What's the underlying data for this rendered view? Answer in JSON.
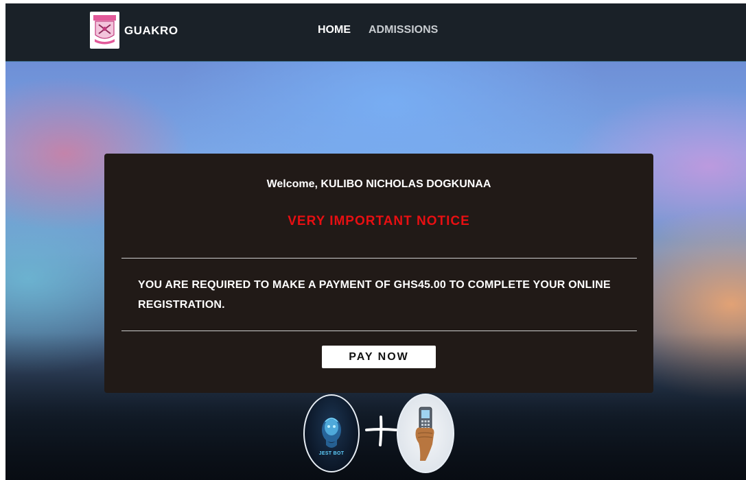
{
  "header": {
    "brand": "GUAKRO",
    "nav": [
      {
        "label": "HOME",
        "active": true
      },
      {
        "label": "ADMISSIONS",
        "active": false
      }
    ]
  },
  "notice": {
    "welcome": "Welcome, KULIBO NICHOLAS DOGKUNAA",
    "title": "VERY IMPORTANT NOTICE",
    "title_color": "#e80f12",
    "message": "YOU ARE REQUIRED TO MAKE A PAYMENT OF GHS45.00 TO COMPLETE YOUR ONLINE REGISTRATION.",
    "button_label": "PAY NOW"
  },
  "badges": {
    "bot_caption": "JEST BOT",
    "icons": [
      "robot-head-icon",
      "plus-icon",
      "mobile-phone-icon"
    ]
  },
  "colors": {
    "header_bg": "#1a2128",
    "card_bg": "#211a17",
    "button_bg": "#ffffff"
  }
}
